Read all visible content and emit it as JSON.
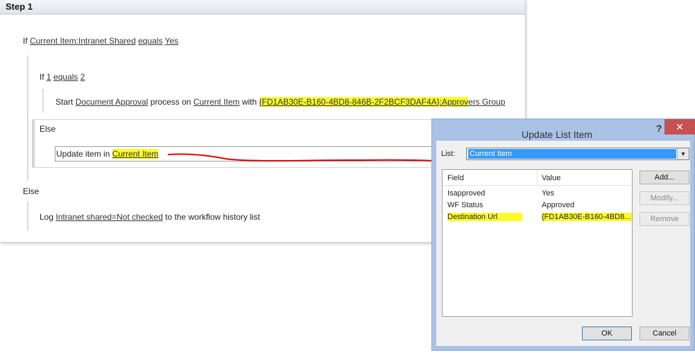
{
  "designer": {
    "step_title": "Step 1",
    "if1": {
      "kw": "If",
      "field": "Current Item:Intranet Shared",
      "op": "equals",
      "value": "Yes"
    },
    "if2": {
      "kw": "If",
      "left": "1",
      "op": "equals",
      "right": "2"
    },
    "start": {
      "kw": "Start",
      "process": "Document Approval",
      "mid": "process on",
      "item": "Current Item",
      "with": "with",
      "group_prefix": "{FD1AB30E-B160-4BD8-846B-2F2BCF3DAF4A}:Approv",
      "group_suffix": "ers Group"
    },
    "else_inner": "Else",
    "update": {
      "text": "Update item in",
      "item": "Current Item"
    },
    "else_outer": "Else",
    "log": {
      "kw": "Log",
      "message": "Intranet shared=Not checked",
      "suffix": "to the workflow history list"
    }
  },
  "dialog": {
    "title": "Update List Item",
    "help": "?",
    "close": "✕",
    "list_label": "List:",
    "list_value": "Current Item",
    "list_arrow": "▼",
    "columns": {
      "field": "Field",
      "value": "Value"
    },
    "rows": [
      {
        "field": "Isapproved",
        "value": "Yes"
      },
      {
        "field": "WF Status",
        "value": "Approved"
      },
      {
        "field": "Destination Url",
        "value": "{FD1AB30E-B160-4BD8..."
      }
    ],
    "buttons": {
      "add": "Add...",
      "modify": "Modify...",
      "remove": "Remove",
      "ok": "OK",
      "cancel": "Cancel"
    }
  },
  "colors": {
    "highlight": "#fbfb2a",
    "dialog_frame": "#aac2e6",
    "close_button": "#c75050",
    "selection": "#3399ff",
    "red_annotation": "#e00000"
  }
}
